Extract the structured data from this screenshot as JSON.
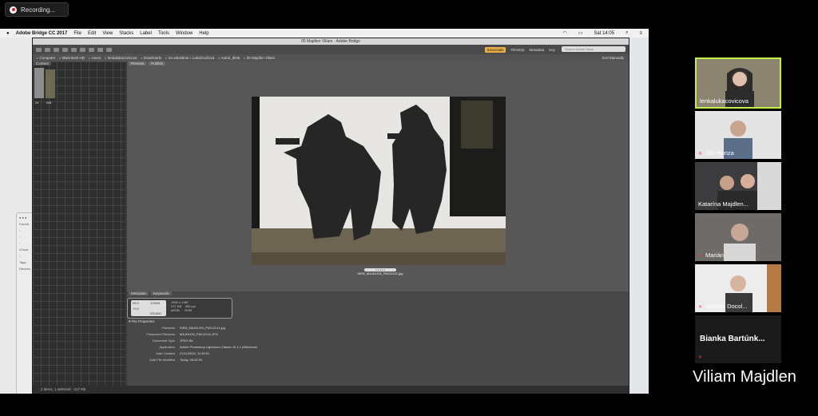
{
  "recording": {
    "label": "Recording..."
  },
  "mac_menu": {
    "app": "Adobe Bridge CC 2017",
    "items": [
      "File",
      "Edit",
      "View",
      "Stacks",
      "Label",
      "Tools",
      "Window",
      "Help"
    ],
    "clock": "Sat 14:05"
  },
  "bridge": {
    "window_title": "05 Majdlen Viliam - Adobe Bridge",
    "workspaces": [
      "Essentials",
      "Filmstrip",
      "Metadata",
      "Key"
    ],
    "search_placeholder": "Search Adobe Stock",
    "breadcrumbs": [
      "Computer",
      "Macintosh HD",
      "Users",
      "lenkalukacovicova",
      "Downloads",
      "na odoslanie i..Lukačovičová",
      "Autori_diela",
      "05 Majdlen Viliam"
    ],
    "sort": "Sort Manually",
    "left_tab": "Content",
    "thumb_labels": [
      "24",
      "WB"
    ],
    "preview_tabs": [
      "Preview",
      "Publish"
    ],
    "file_caption": "WEB_MAJDLEN_P8212141.jpg",
    "meta_tabs": [
      "Metadata",
      "Keywords"
    ],
    "badge": {
      "aperture": "f/5.0",
      "shutter": "1/1600",
      "ev": "+0,0",
      "iso": "ISO400",
      "dims": "1000 x 1387",
      "size": "217 KB",
      "ppi": "300 ppi",
      "color_mode": "sRGB",
      "mode": "RGB"
    },
    "file_props_title": "File Properties",
    "file_props": [
      {
        "key": "Filename",
        "value": "WEB_MAJDLEN_P8212141.jpg"
      },
      {
        "key": "Preserved Filename",
        "value": "MAJDLEN_P8212141.JPG"
      },
      {
        "key": "Document Type",
        "value": "JPEG file"
      },
      {
        "key": "Application",
        "value": "Adobe Photoshop Lightroom Classic 10.1.1 (Windows)"
      },
      {
        "key": "Date Created",
        "value": "21/11/2020, 11:49:51"
      },
      {
        "key": "Date File Modified",
        "value": "Today, 08:45:54"
      }
    ],
    "status": "2 items, 1 selected - 217 KB"
  },
  "participants": [
    {
      "name": "lenkalukacovicova",
      "muted": false,
      "active": true
    },
    {
      "name": "Ján Honza",
      "muted": true,
      "active": false
    },
    {
      "name": "Katarína Majdlen...",
      "muted": false,
      "active": false
    },
    {
      "name": "Marián",
      "muted": true,
      "active": false
    },
    {
      "name": "Martina Docol...",
      "muted": true,
      "active": false
    },
    {
      "name": "Bianka Bartúnk...",
      "muted": true,
      "active": false
    }
  ],
  "speaker_name": "Viliam Majdlen",
  "colors": {
    "active_border": "#c6ee4a",
    "workspace_active": "#e8b046",
    "muted_icon": "#e44444"
  }
}
